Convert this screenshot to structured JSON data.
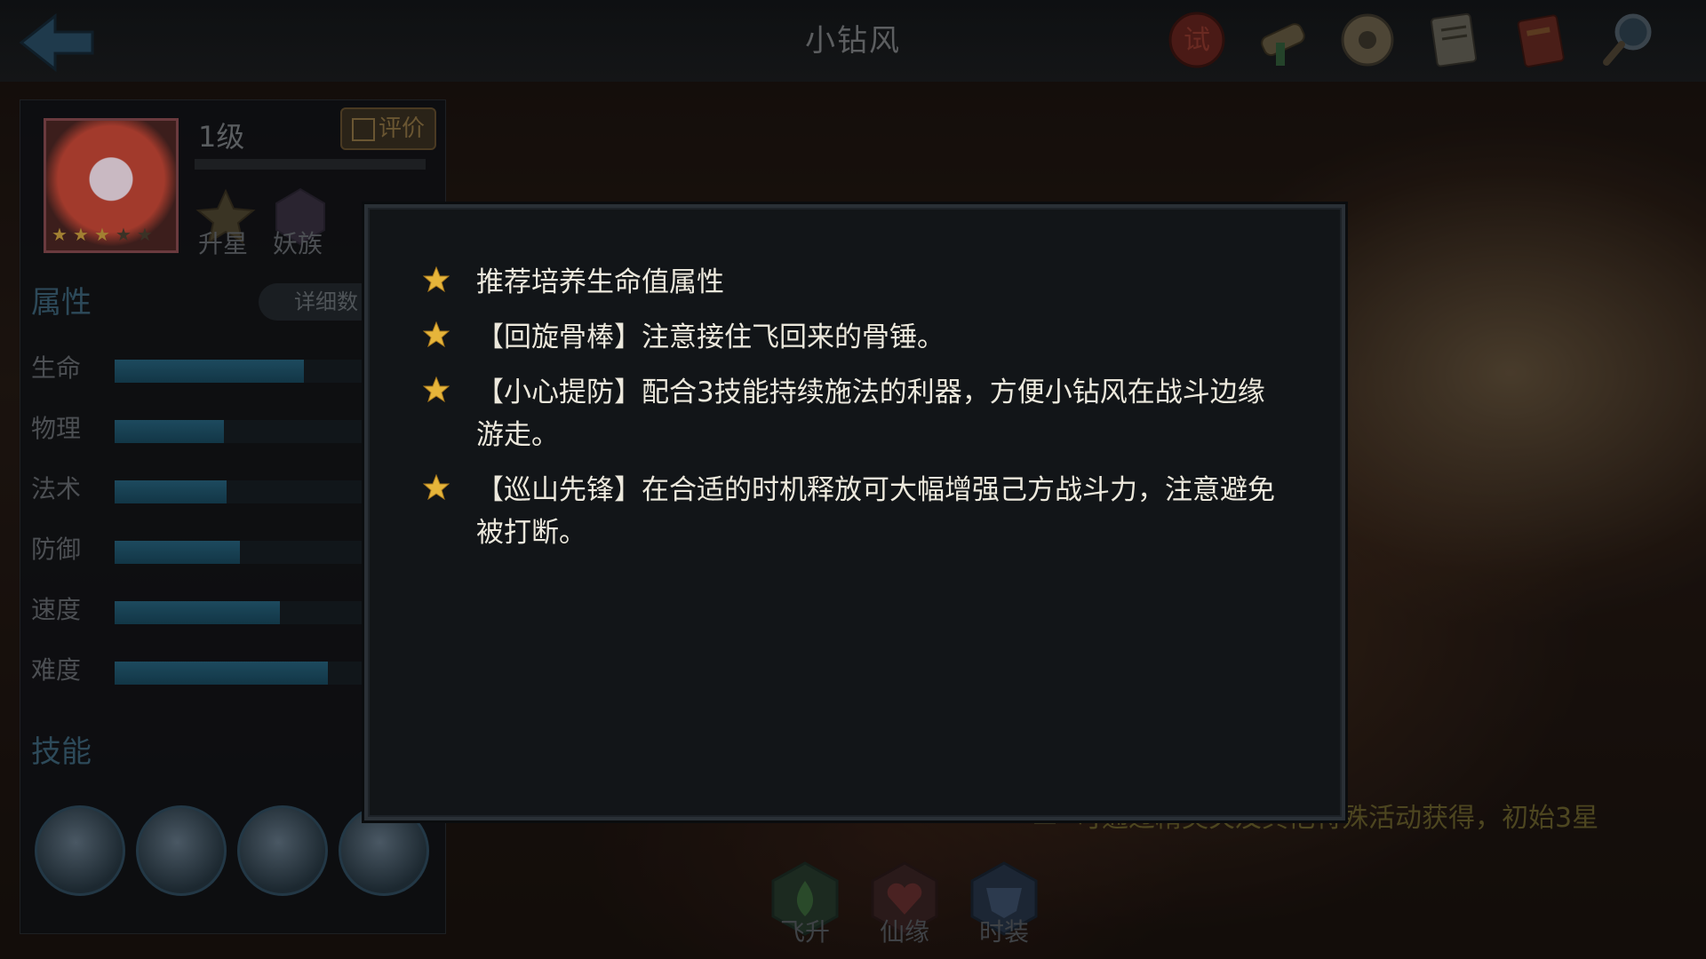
{
  "header": {
    "title": "小钻风",
    "icons": [
      "trial-seal-icon",
      "scroll-icon",
      "coin-icon",
      "notice-icon",
      "book-icon",
      "magnifier-icon"
    ]
  },
  "hero": {
    "level": "1级",
    "rate_label": "评价",
    "stars": 3,
    "max_stars": 5,
    "tags": [
      "升星",
      "妖族"
    ]
  },
  "attributes": {
    "title": "属性",
    "detail_label": "详细数",
    "items": [
      {
        "label": "生命",
        "level": 0.71
      },
      {
        "label": "物理",
        "level": 0.41
      },
      {
        "label": "法术",
        "level": 0.42
      },
      {
        "label": "防御",
        "level": 0.47
      },
      {
        "label": "速度",
        "level": 0.62
      },
      {
        "label": "难度",
        "level": 0.8
      }
    ]
  },
  "skills": {
    "title": "技能",
    "icons": [
      "bone-club-skill-icon",
      "armored-warrior-skill-icon",
      "spinning-hammer-skill-icon",
      "wind-skill-icon"
    ]
  },
  "bottom_tabs": [
    {
      "label": "飞升",
      "icon": "flame-icon"
    },
    {
      "label": "仙缘",
      "icon": "heart-icon"
    },
    {
      "label": "时装",
      "icon": "mask-icon"
    }
  ],
  "bottom_note": "可通过精英关及其他特殊活动获得，初始3星",
  "modal": {
    "tips": [
      "推荐培养生命值属性",
      "【回旋骨棒】注意接住飞回来的骨锤。",
      "【小心提防】配合3技能持续施法的利器，方便小钻风在战斗边缘游走。",
      "【巡山先锋】在合适的时机释放可大幅增强己方战斗力，注意避免被打断。"
    ]
  },
  "colors": {
    "tip_text": "#ece8dc",
    "star": "#e6b53a",
    "bar_fill": "#1d4a5e",
    "panel_header": "#2d4a5a"
  }
}
